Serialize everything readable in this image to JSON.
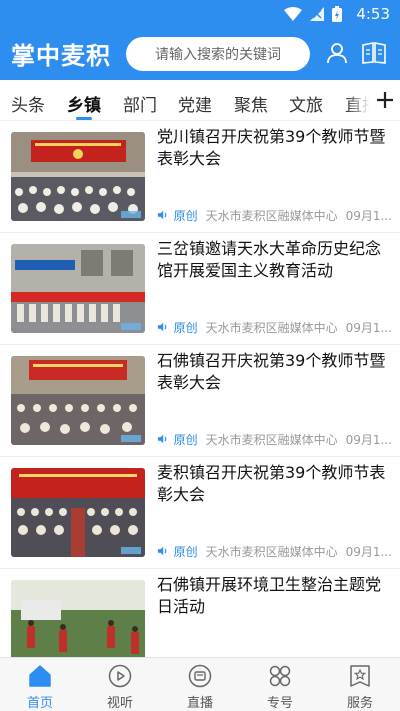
{
  "status_bar": {
    "time": "4:53"
  },
  "app": {
    "title": "掌中麦积"
  },
  "search": {
    "placeholder": "请输入搜索的关键词"
  },
  "tabs": [
    {
      "label": "头条"
    },
    {
      "label": "乡镇",
      "active": true
    },
    {
      "label": "部门"
    },
    {
      "label": "党建"
    },
    {
      "label": "聚焦"
    },
    {
      "label": "文旅"
    },
    {
      "label": "直播"
    }
  ],
  "news": [
    {
      "title": "党川镇召开庆祝第39个教师节暨表彰大会",
      "tag": "原创",
      "source": "天水市麦积区融媒体中心",
      "date": "09月1..."
    },
    {
      "title": "三岔镇邀请天水大革命历史纪念馆开展爱国主义教育活动",
      "tag": "原创",
      "source": "天水市麦积区融媒体中心",
      "date": "09月1..."
    },
    {
      "title": "石佛镇召开庆祝第39个教师节暨表彰大会",
      "tag": "原创",
      "source": "天水市麦积区融媒体中心",
      "date": "09月1..."
    },
    {
      "title": "麦积镇召开庆祝第39个教师节表彰大会",
      "tag": "原创",
      "source": "天水市麦积区融媒体中心",
      "date": "09月1..."
    },
    {
      "title": "石佛镇开展环境卫生整治主题党日活动",
      "tag": "",
      "source": "",
      "date": ""
    }
  ],
  "bottom_nav": [
    {
      "label": "首页",
      "icon": "home-icon",
      "active": true
    },
    {
      "label": "视听",
      "icon": "play-icon"
    },
    {
      "label": "直播",
      "icon": "tv-icon"
    },
    {
      "label": "专号",
      "icon": "grid-circles-icon"
    },
    {
      "label": "服务",
      "icon": "star-box-icon"
    }
  ],
  "colors": {
    "brand": "#2d8ef0",
    "tag": "#2d8ef0",
    "meta": "#999999"
  }
}
